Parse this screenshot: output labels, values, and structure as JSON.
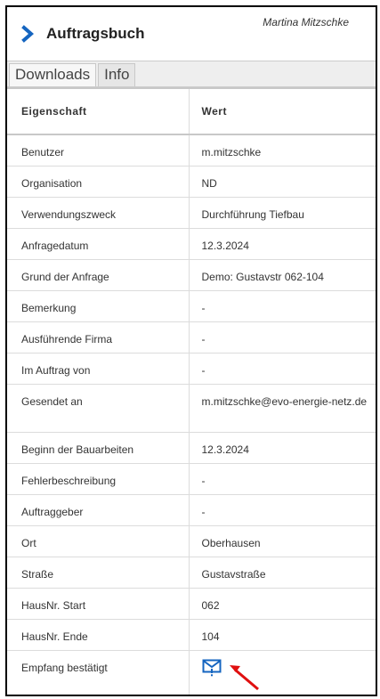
{
  "header": {
    "title": "Auftragsbuch",
    "user_name": "Martina Mitzschke"
  },
  "tabs": [
    {
      "label": "Downloads",
      "active": true
    },
    {
      "label": "Info",
      "active": false
    }
  ],
  "table": {
    "columns": [
      "Eigenschaft",
      "Wert"
    ],
    "rows": [
      {
        "property": "Benutzer",
        "value": "m.mitzschke"
      },
      {
        "property": "Organisation",
        "value": "ND"
      },
      {
        "property": "Verwendungszweck",
        "value": "Durchführung Tiefbau"
      },
      {
        "property": "Anfragedatum",
        "value": "12.3.2024"
      },
      {
        "property": "Grund der Anfrage",
        "value": "Demo: Gustavstr 062-104"
      },
      {
        "property": "Bemerkung",
        "value": "-"
      },
      {
        "property": "Ausführende Firma",
        "value": "-"
      },
      {
        "property": "Im Auftrag von",
        "value": "-"
      },
      {
        "property": "Gesendet an",
        "value": "m.mitzschke@evo-energie-netz.de"
      },
      {
        "property": "Beginn der Bauarbeiten",
        "value": "12.3.2024"
      },
      {
        "property": "Fehlerbeschreibung",
        "value": "-"
      },
      {
        "property": "Auftraggeber",
        "value": "-"
      },
      {
        "property": "Ort",
        "value": "Oberhausen"
      },
      {
        "property": "Straße",
        "value": "Gustavstraße"
      },
      {
        "property": "HausNr. Start",
        "value": "062"
      },
      {
        "property": "HausNr. Ende",
        "value": "104"
      },
      {
        "property": "Empfang bestätigt",
        "value": ""
      }
    ]
  },
  "icons": {
    "header_chevron": "chevron-right-icon",
    "receipt": "mail-confirmed-icon",
    "annotation": "red-arrow-icon"
  },
  "colors": {
    "accent": "#1565c0",
    "annotation": "#e01010"
  }
}
